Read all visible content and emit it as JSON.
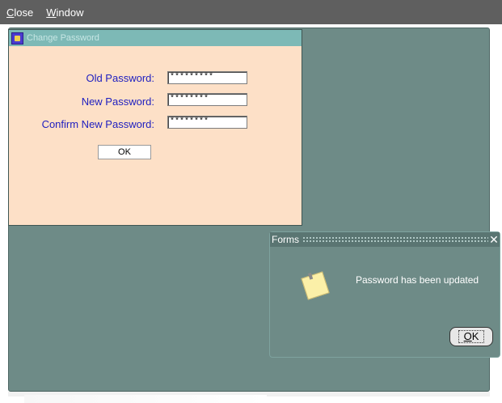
{
  "menubar": {
    "items": [
      {
        "first": "C",
        "rest": "lose"
      },
      {
        "first": "W",
        "rest": "indow"
      }
    ]
  },
  "change_password": {
    "title": "Change Password",
    "old_label": "Old Password:",
    "new_label": "New Password:",
    "confirm_label": "Confirm New Password:",
    "old_value": "*********",
    "new_value": "********",
    "confirm_value": "********",
    "ok_label": "OK"
  },
  "alert": {
    "title": "Forms",
    "close_glyph": "✕",
    "message": "Password has been updated",
    "ok_first": "O",
    "ok_rest": "K",
    "icon": "note-icon"
  },
  "colors": {
    "menubar": "#5f5f5f",
    "mdi_background": "#6e8b87",
    "form_background": "#fde0c7",
    "label_text": "#2020c0",
    "titlebar": "#7db9b6"
  }
}
